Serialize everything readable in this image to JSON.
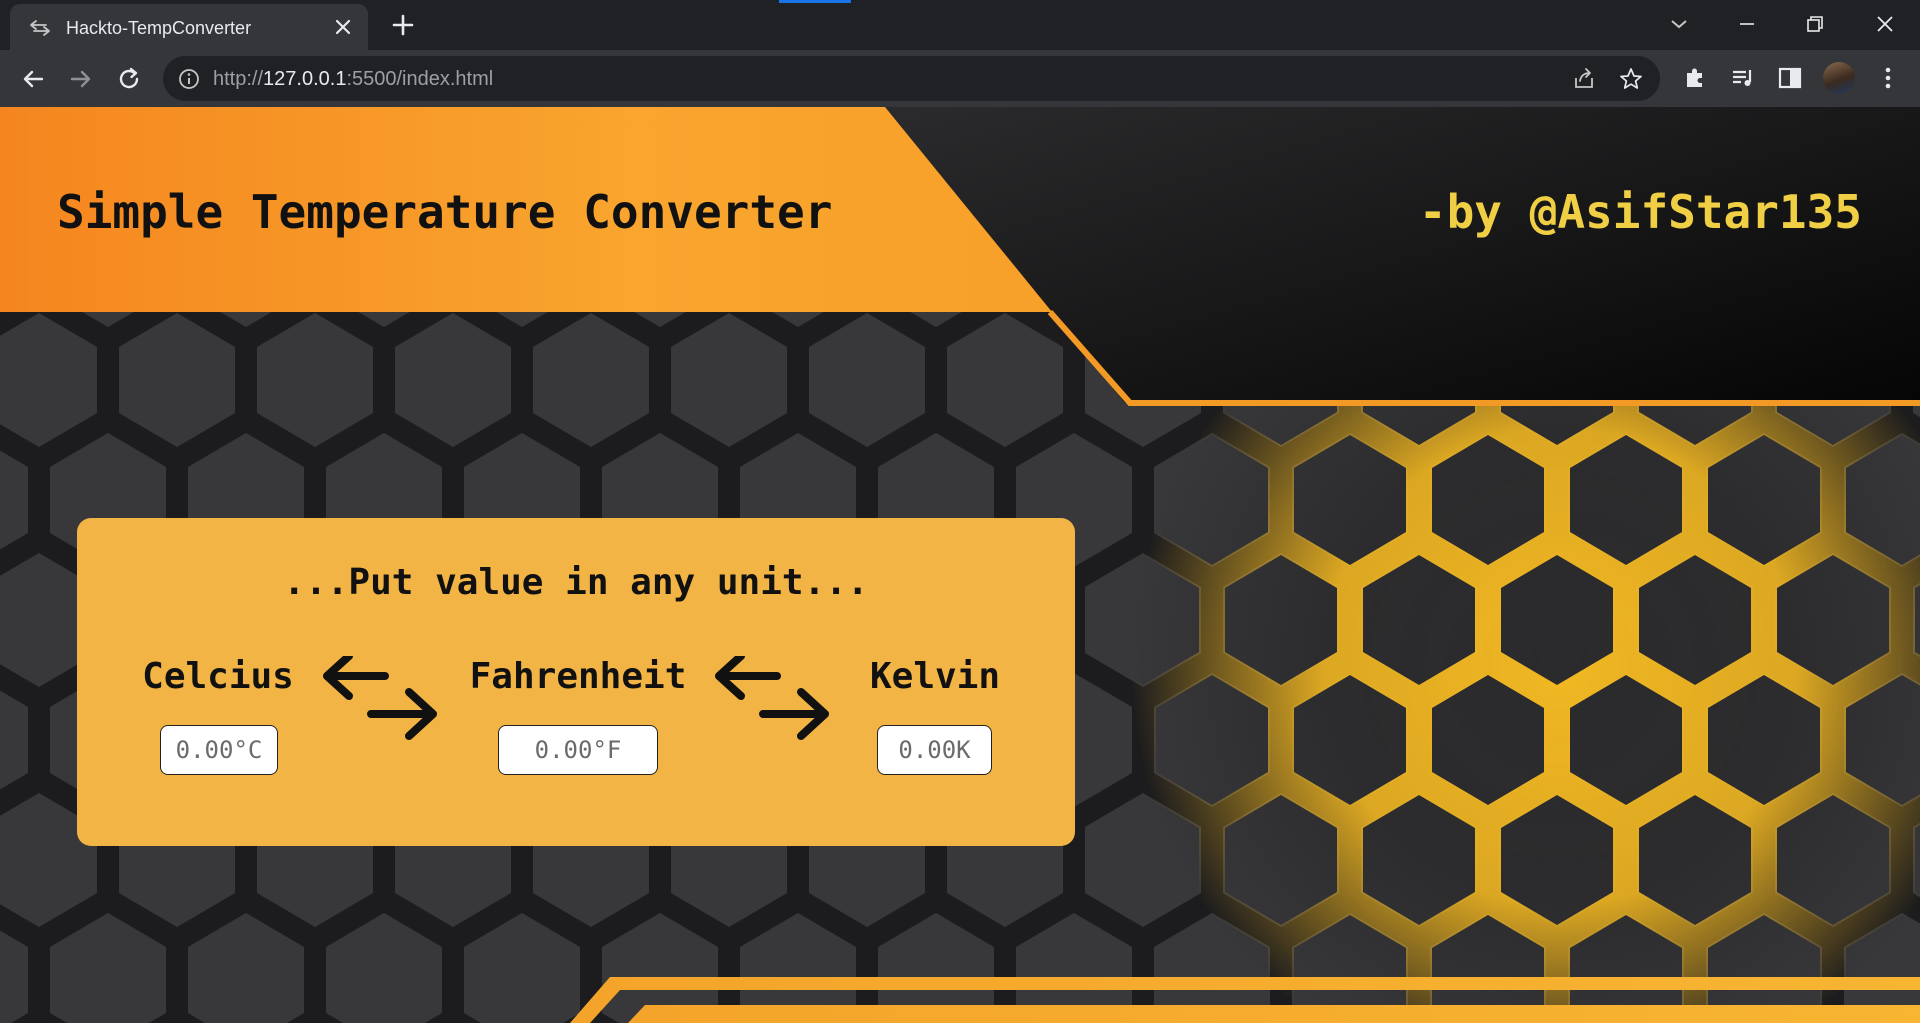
{
  "browser": {
    "tab_title": "Hackto-TempConverter",
    "url_scheme": "http://",
    "url_host": "127.0.0.1",
    "url_rest": ":5500/index.html"
  },
  "page": {
    "heading": "Simple Temperature Converter",
    "author": "-by @AsifStar135",
    "prompt": "...Put value in any unit...",
    "units": [
      {
        "label": "Celcius",
        "placeholder": "0.00°C"
      },
      {
        "label": "Fahrenheit",
        "placeholder": "0.00°F"
      },
      {
        "label": "Kelvin",
        "placeholder": "0.00K"
      }
    ]
  },
  "colors": {
    "accent_orange": "#f7a02c",
    "card_bg": "#f2b444",
    "author_yellow": "#f0cf44",
    "load_indicator": "#1a73e8"
  }
}
